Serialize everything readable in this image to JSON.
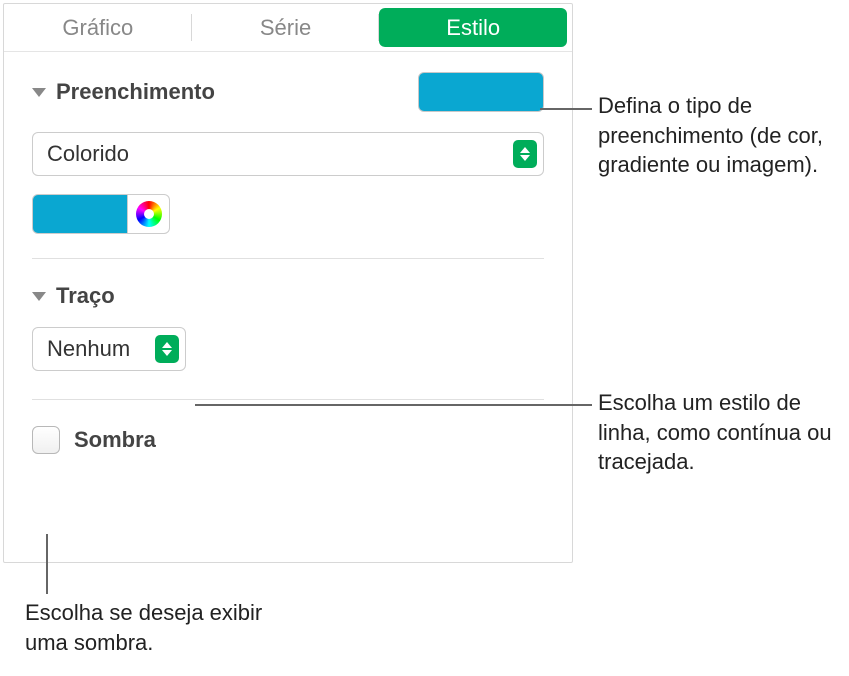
{
  "tabs": {
    "chart": "Gráfico",
    "series": "Série",
    "style": "Estilo"
  },
  "fill": {
    "title": "Preenchimento",
    "dropdown_value": "Colorido",
    "swatch_color": "#0aa7d1"
  },
  "stroke": {
    "title": "Traço",
    "dropdown_value": "Nenhum"
  },
  "shadow": {
    "label": "Sombra"
  },
  "callouts": {
    "fill": "Defina o tipo de preenchimento (de cor, gradiente ou imagem).",
    "stroke": "Escolha um estilo de linha, como contínua ou tracejada.",
    "shadow": "Escolha se deseja exibir uma sombra."
  }
}
